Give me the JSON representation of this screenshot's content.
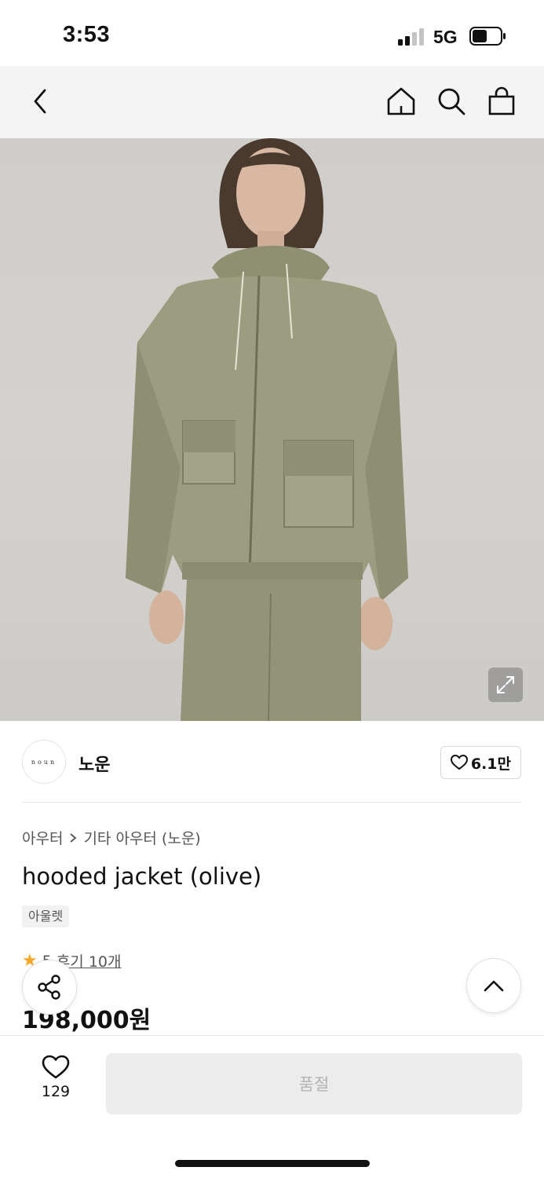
{
  "status_bar": {
    "time": "3:53",
    "network": "5G",
    "signal_bars_filled": 2,
    "signal_bars_total": 4,
    "battery_level": 0.45
  },
  "nav": {
    "icons": [
      "back-arrow-icon",
      "home-icon",
      "search-icon",
      "shopping-bag-icon"
    ]
  },
  "product_image": {
    "expand_icon": "expand-icon"
  },
  "brand": {
    "logo_text": "noun",
    "name": "노운",
    "likes": "6.1만"
  },
  "breadcrumb": {
    "level1": "아우터",
    "level2": "기타 아우터 (노운)"
  },
  "product": {
    "title": "hooded jacket (olive)",
    "tag": "아울렛",
    "rating": "5",
    "reviews": "후기 10개",
    "price": "198,000원"
  },
  "bottom_bar": {
    "wish_count": "129",
    "action_label": "품절"
  },
  "colors": {
    "accent_star": "#f5a623",
    "disabled_button_bg": "#ececec",
    "disabled_button_text": "#b4b4b4",
    "jacket_olive": "#9c9c80"
  }
}
